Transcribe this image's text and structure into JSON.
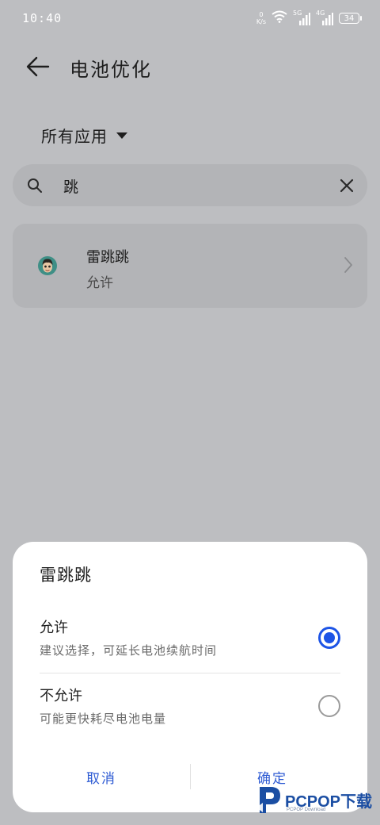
{
  "status_bar": {
    "time": "10:40",
    "net_speed_value": "0",
    "net_speed_unit": "K/s",
    "sim1_label": "5G",
    "sim2_label": "4G",
    "battery_level": "34"
  },
  "header": {
    "title": "电池优化"
  },
  "filter": {
    "label": "所有应用"
  },
  "search": {
    "value": "跳"
  },
  "app_list": [
    {
      "name": "雷跳跳",
      "status": "允许"
    }
  ],
  "dialog": {
    "title": "雷跳跳",
    "options": [
      {
        "title": "允许",
        "description": "建议选择，可延长电池续航时间",
        "selected": true
      },
      {
        "title": "不允许",
        "description": "可能更快耗尽电池电量",
        "selected": false
      }
    ],
    "cancel_label": "取消",
    "confirm_label": "确定",
    "accent_color": "#1d54e6"
  },
  "watermark": {
    "brand": "PCPOP下载",
    "sub": "PCPOP Download"
  }
}
